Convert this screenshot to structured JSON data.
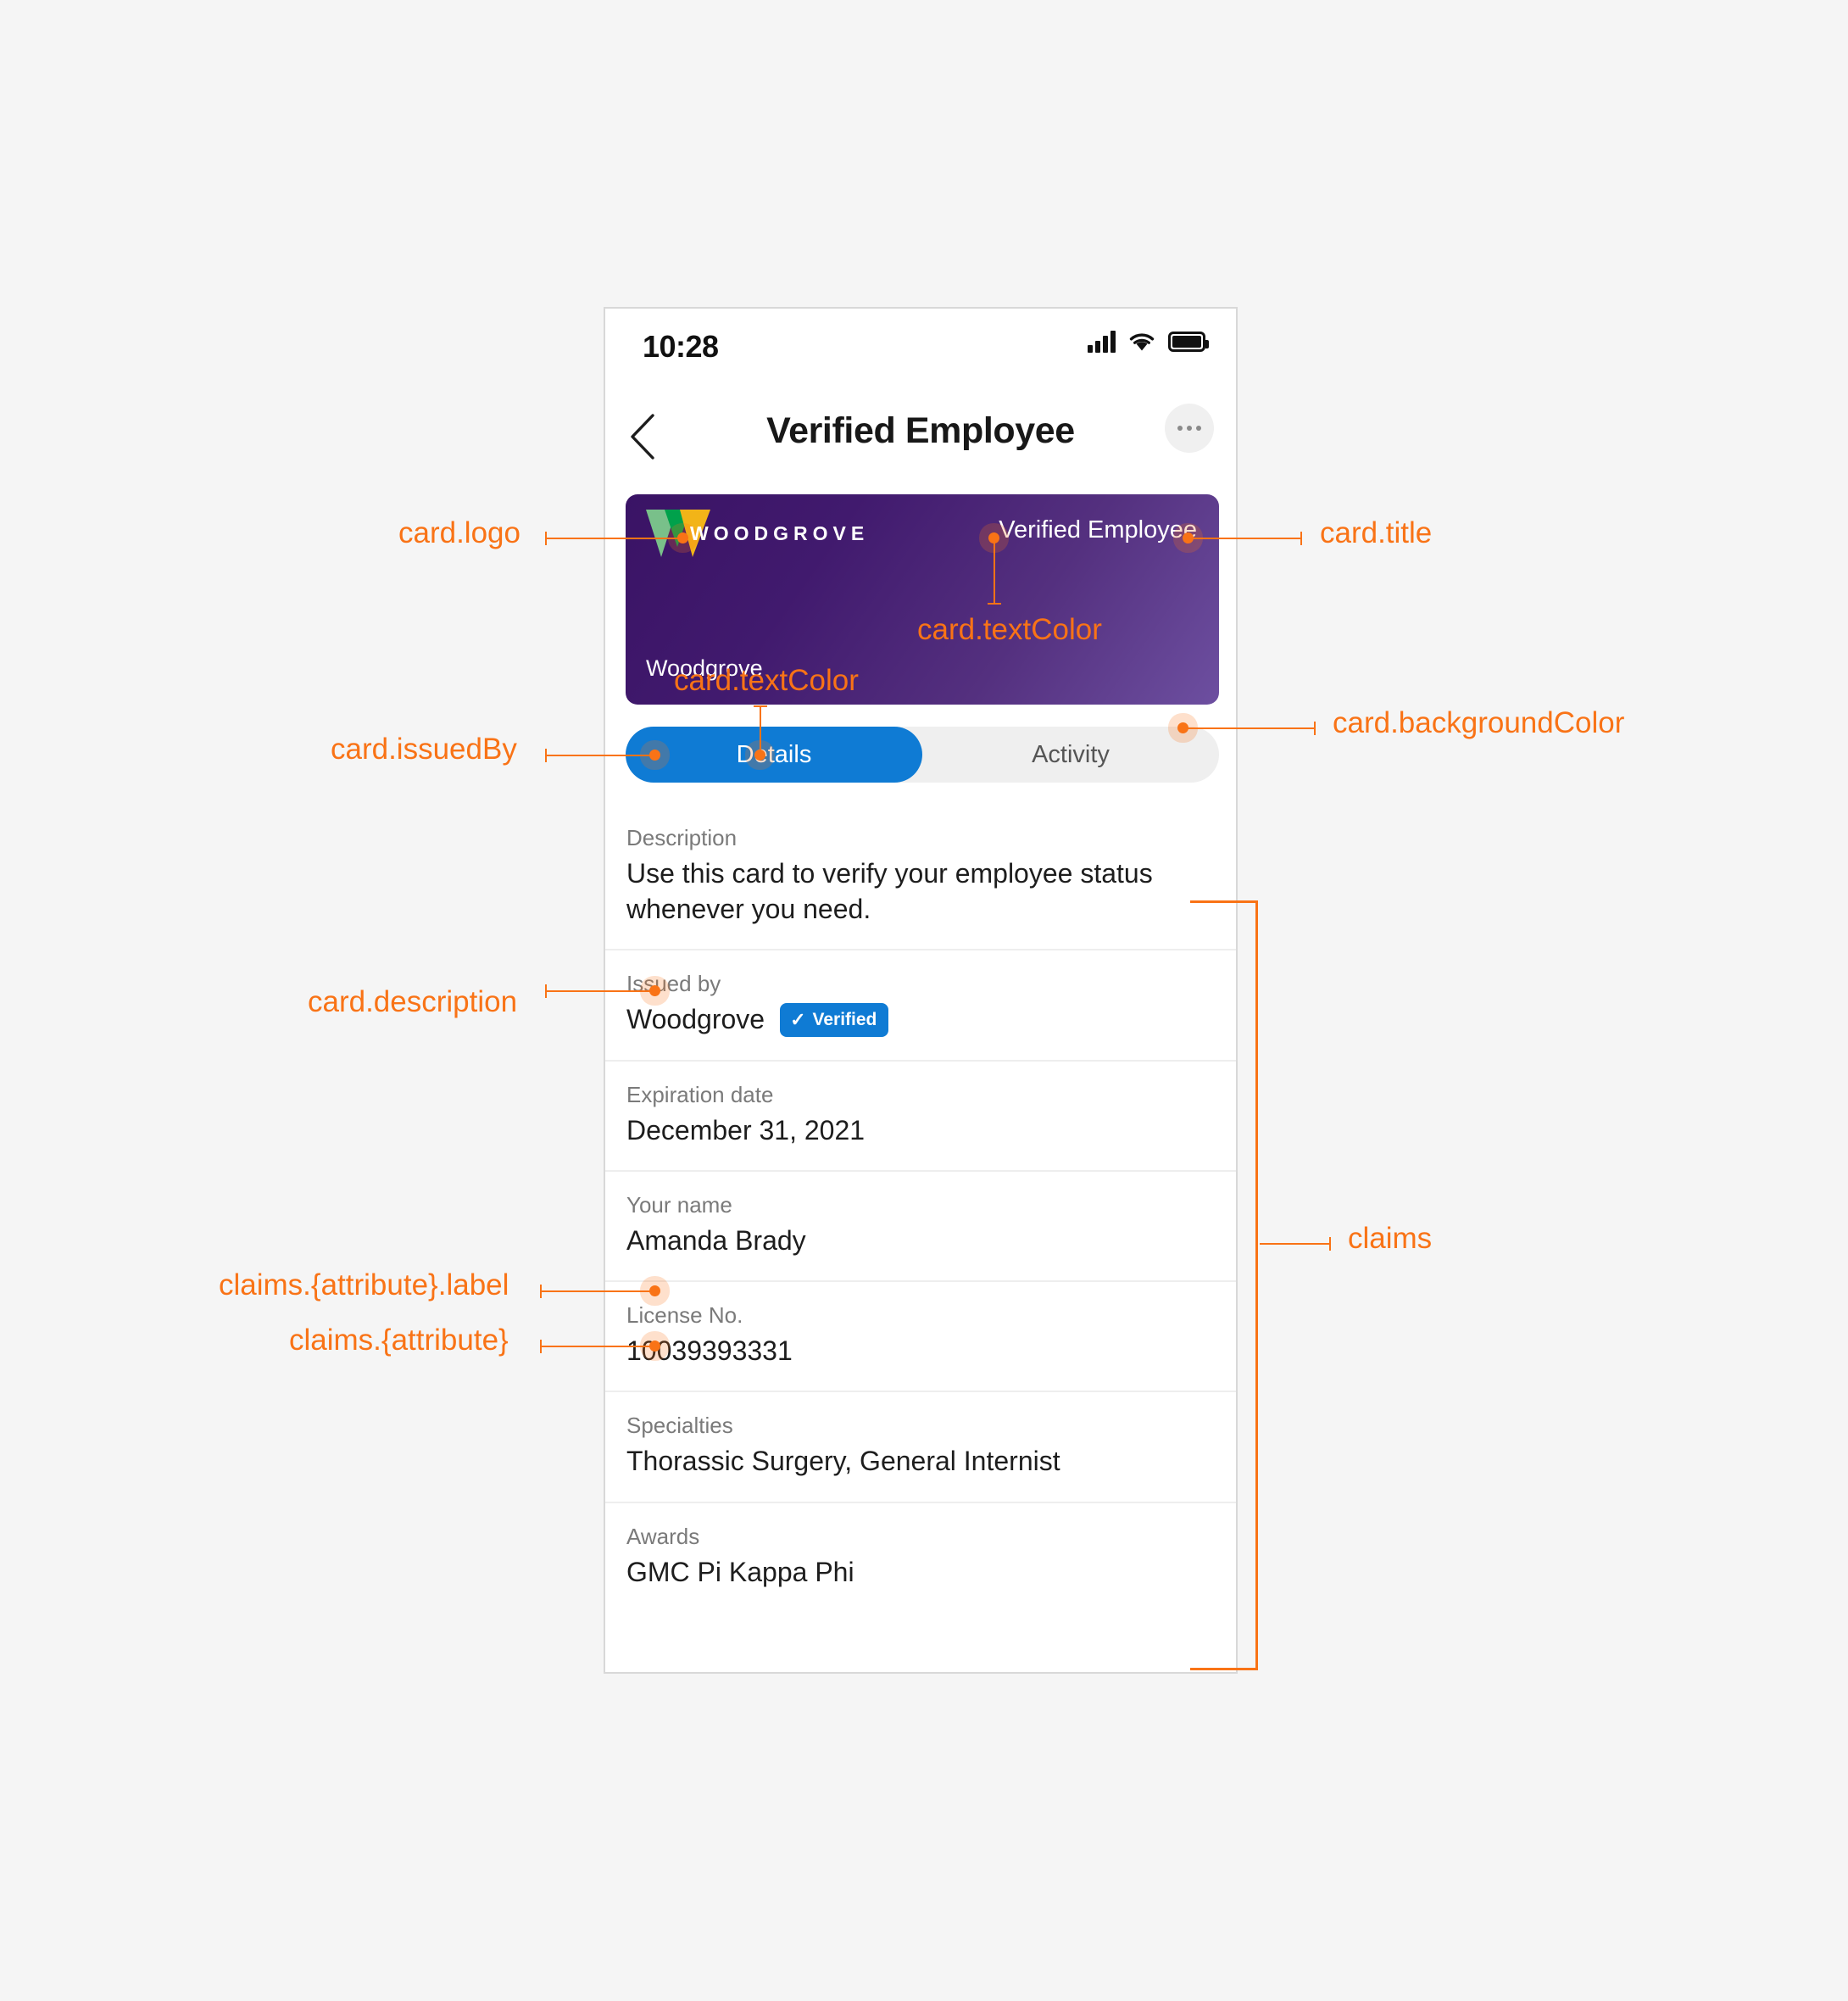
{
  "status_bar": {
    "time": "10:28",
    "signal_icon": "signal-bars-icon",
    "wifi_icon": "wifi-icon",
    "battery_icon": "battery-full-icon"
  },
  "nav": {
    "back_icon": "back-chevron-icon",
    "title": "Verified Employee",
    "more_icon": "more-options-icon"
  },
  "card": {
    "logo_text": "WOODGROVE",
    "logo_icon": "woodgrove-w-logo",
    "title": "Verified Employee",
    "issued_by": "Woodgrove",
    "background_color": "#3a1365",
    "background_color_end": "#6d4fa0",
    "text_color": "#ffffff"
  },
  "tabs": [
    {
      "label": "Details",
      "active": true
    },
    {
      "label": "Activity",
      "active": false
    }
  ],
  "details": {
    "description": {
      "label": "Description",
      "value": "Use this card to verify your employee status whenever you need."
    },
    "issued_by": {
      "label": "Issued by",
      "value": "Woodgrove",
      "badge": "Verified",
      "badge_icon": "check-icon",
      "badge_color": "#0f7bd4"
    },
    "expiration": {
      "label": "Expiration date",
      "value": "December 31, 2021"
    },
    "claims": [
      {
        "label": "Your name",
        "value": "Amanda Brady"
      },
      {
        "label": "License No.",
        "value": "10039393331"
      },
      {
        "label": "Specialties",
        "value": "Thorassic Surgery, General Internist"
      },
      {
        "label": "Awards",
        "value": "GMC Pi Kappa Phi"
      }
    ]
  },
  "annotations": {
    "accent_color": "#f97316",
    "card_logo": "card.logo",
    "card_title": "card.title",
    "card_text_color_title": "card.textColor",
    "card_text_color_issuer": "card.textColor",
    "card_issued_by": "card.issuedBy",
    "card_background_color": "card.backgroundColor",
    "card_description": "card.description",
    "claims": "claims",
    "claims_attribute_label": "claims.{attribute}.label",
    "claims_attribute": "claims.{attribute}"
  }
}
